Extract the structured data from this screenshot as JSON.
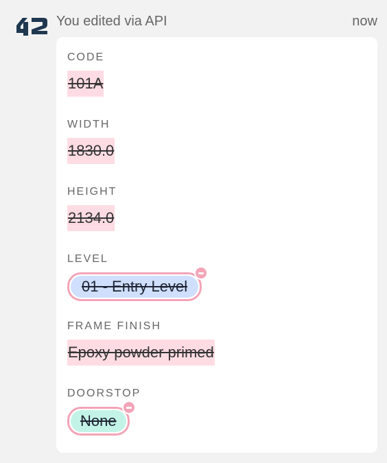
{
  "header": {
    "actor_text": "You edited via API",
    "timestamp": "now",
    "logo_icon": "api-42-logo-icon"
  },
  "fields": [
    {
      "label": "CODE",
      "value": "101A"
    },
    {
      "label": "WIDTH",
      "value": "1830.0"
    },
    {
      "label": "HEIGHT",
      "value": "2134.0"
    },
    {
      "label": "LEVEL",
      "value": "01 - Entry Level"
    },
    {
      "label": "FRAME FINISH",
      "value": "Epoxy powder primed"
    },
    {
      "label": "DOORSTOP",
      "value": "None"
    }
  ],
  "colors": {
    "removed_highlight": "#ffdce4",
    "chip_level": "#cfdffd",
    "chip_doorstop": "#c3f3e7",
    "removed_outline": "#f4a4b8",
    "logo": "#1f3850"
  }
}
